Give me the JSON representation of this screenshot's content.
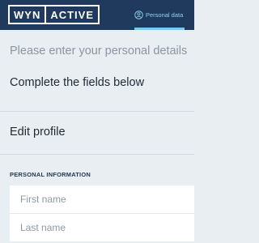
{
  "header": {
    "logo_left": "WYN",
    "logo_right": "ACTIVE",
    "personal_tab_label": "Personal data",
    "personal_tab_icon": "user-circle-icon"
  },
  "intro": {
    "title": "Please enter your personal details",
    "subtitle": "Complete the fields below"
  },
  "profile": {
    "edit_label": "Edit profile"
  },
  "personal_information": {
    "section_label": "PERSONAL INFORMATION",
    "first_name_placeholder": "First name",
    "last_name_placeholder": "Last name"
  },
  "colors": {
    "header_bg": "#1f3a5c",
    "accent": "#7ac8ec",
    "page_bg": "#e9eef2"
  }
}
